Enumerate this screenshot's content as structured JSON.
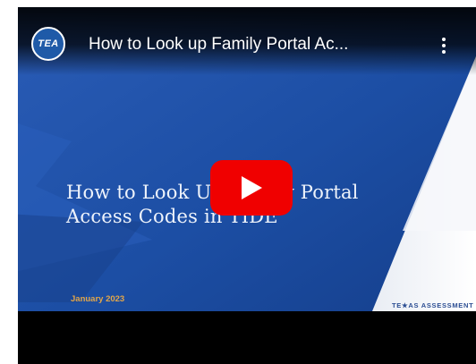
{
  "video": {
    "title": "How to Look up Family Portal Ac...",
    "channel_logo": "TEA",
    "menu_icon": "more-vert-icon",
    "play_icon": "play-icon"
  },
  "slide": {
    "title_line1": "How to Look Up Family Portal",
    "title_line2": "Access Codes in TIDE",
    "date": "January 2023",
    "brand": "TE★AS ASSESSMENT"
  },
  "colors": {
    "slide_blue": "#1d4fa6",
    "play_red": "#f00000",
    "date_gold": "#e2a64a"
  }
}
